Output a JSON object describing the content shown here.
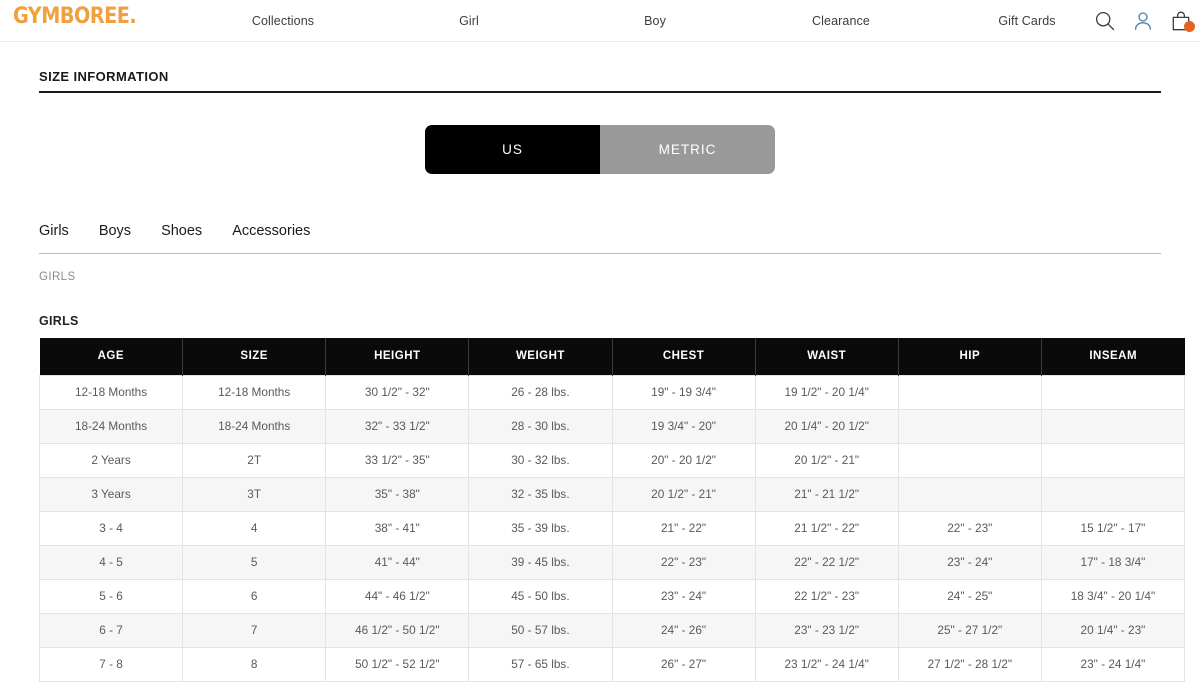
{
  "header": {
    "logo_text": "GYMBOREE",
    "nav": [
      {
        "label": "Collections"
      },
      {
        "label": "Girl"
      },
      {
        "label": "Boy"
      },
      {
        "label": "Clearance"
      },
      {
        "label": "Gift Cards"
      }
    ],
    "icons": {
      "search": "search-icon",
      "account": "user-icon",
      "cart": "shopping-bag-icon"
    },
    "brand_color": "#F0A03C",
    "cart_badge_color": "#E2641E"
  },
  "page": {
    "section_title": "SIZE INFORMATION",
    "unit_toggle": {
      "options": [
        {
          "label": "US",
          "active": true
        },
        {
          "label": "METRIC",
          "active": false
        }
      ],
      "active_color": "#000000",
      "inactive_color": "#999999"
    },
    "tabs": [
      {
        "label": "Girls"
      },
      {
        "label": "Boys"
      },
      {
        "label": "Shoes"
      },
      {
        "label": "Accessories"
      }
    ],
    "breadcrumb": "GIRLS",
    "table_title": "GIRLS"
  },
  "table": {
    "columns": [
      "AGE",
      "SIZE",
      "HEIGHT",
      "WEIGHT",
      "CHEST",
      "WAIST",
      "HIP",
      "INSEAM"
    ],
    "rows": [
      [
        "12-18 Months",
        "12-18 Months",
        "30 1/2\" - 32\"",
        "26 - 28 lbs.",
        "19\" - 19 3/4\"",
        "19 1/2\" - 20 1/4\"",
        "",
        ""
      ],
      [
        "18-24 Months",
        "18-24 Months",
        "32\" - 33 1/2\"",
        "28 - 30 lbs.",
        "19 3/4\" - 20\"",
        "20 1/4\" - 20 1/2\"",
        "",
        ""
      ],
      [
        "2 Years",
        "2T",
        "33 1/2\" - 35\"",
        "30 - 32 lbs.",
        "20\" - 20 1/2\"",
        "20 1/2\" - 21\"",
        "",
        ""
      ],
      [
        "3 Years",
        "3T",
        "35\" - 38\"",
        "32 - 35 lbs.",
        "20 1/2\" - 21\"",
        "21\" - 21 1/2\"",
        "",
        ""
      ],
      [
        "3 - 4",
        "4",
        "38\" - 41\"",
        "35 - 39 lbs.",
        "21\" - 22\"",
        "21 1/2\" - 22\"",
        "22\" - 23\"",
        "15 1/2\" - 17\""
      ],
      [
        "4 - 5",
        "5",
        "41\" - 44\"",
        "39 - 45 lbs.",
        "22\" - 23\"",
        "22\" - 22 1/2\"",
        "23\" - 24\"",
        "17\" - 18 3/4\""
      ],
      [
        "5 - 6",
        "6",
        "44\" - 46 1/2\"",
        "45 - 50 lbs.",
        "23\" - 24\"",
        "22 1/2\" - 23\"",
        "24\" - 25\"",
        "18 3/4\" - 20 1/4\""
      ],
      [
        "6 - 7",
        "7",
        "46 1/2\" - 50 1/2\"",
        "50 - 57 lbs.",
        "24\" - 26\"",
        "23\" - 23 1/2\"",
        "25\" - 27 1/2\"",
        "20 1/4\" - 23\""
      ],
      [
        "7 - 8",
        "8",
        "50 1/2\" - 52 1/2\"",
        "57 - 65 lbs.",
        "26\" - 27\"",
        "23 1/2\" - 24 1/4\"",
        "27 1/2\" - 28 1/2\"",
        "23\" - 24 1/4\""
      ]
    ]
  }
}
